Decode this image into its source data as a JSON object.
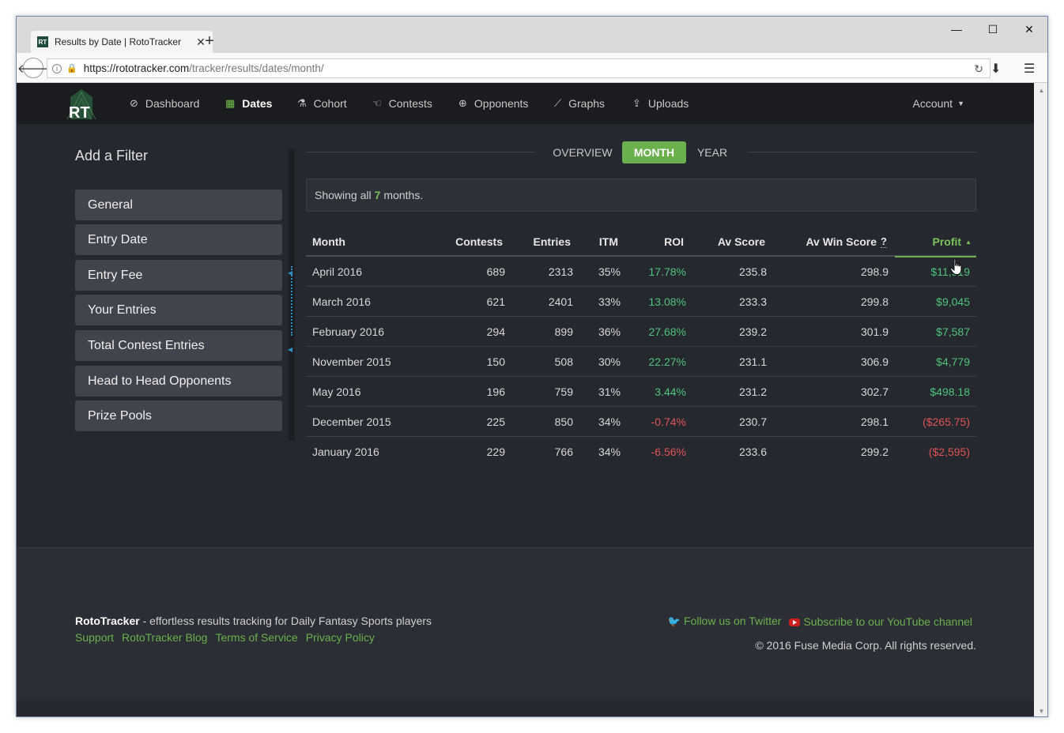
{
  "browser": {
    "tab_title": "Results by Date | RotoTracker",
    "tab_favicon": "RT",
    "url_host": "https://rototracker.com",
    "url_path": "/tracker/results/dates/month/"
  },
  "nav": {
    "items": [
      {
        "label": "Dashboard",
        "icon": "compass-icon"
      },
      {
        "label": "Dates",
        "icon": "calendar-icon",
        "active": true
      },
      {
        "label": "Cohort",
        "icon": "flask-icon"
      },
      {
        "label": "Contests",
        "icon": "hand-icon"
      },
      {
        "label": "Opponents",
        "icon": "crosshair-icon"
      },
      {
        "label": "Graphs",
        "icon": "line-chart-icon"
      },
      {
        "label": "Uploads",
        "icon": "upload-icon"
      }
    ],
    "account_label": "Account"
  },
  "sidebar": {
    "title": "Add a Filter",
    "filters": [
      "General",
      "Entry Date",
      "Entry Fee",
      "Your Entries",
      "Total Contest Entries",
      "Head to Head Opponents",
      "Prize Pools"
    ]
  },
  "view_tabs": {
    "overview": "OVERVIEW",
    "month": "MONTH",
    "year": "YEAR",
    "active": "MONTH"
  },
  "summary": {
    "prefix": "Showing all",
    "count": "7",
    "suffix": "months."
  },
  "table": {
    "headers": {
      "month": "Month",
      "contests": "Contests",
      "entries": "Entries",
      "itm": "ITM",
      "roi": "ROI",
      "av_score": "Av Score",
      "av_win_score": "Av Win Score",
      "av_win_score_hint": "?",
      "profit": "Profit"
    },
    "sort_column": "Profit",
    "sort_direction": "desc",
    "rows": [
      {
        "month": "April 2016",
        "contests": "689",
        "entries": "2313",
        "itm": "35%",
        "roi": "17.78%",
        "av_score": "235.8",
        "av_win_score": "298.9",
        "profit": "$11,919",
        "positive": true
      },
      {
        "month": "March 2016",
        "contests": "621",
        "entries": "2401",
        "itm": "33%",
        "roi": "13.08%",
        "av_score": "233.3",
        "av_win_score": "299.8",
        "profit": "$9,045",
        "positive": true
      },
      {
        "month": "February 2016",
        "contests": "294",
        "entries": "899",
        "itm": "36%",
        "roi": "27.68%",
        "av_score": "239.2",
        "av_win_score": "301.9",
        "profit": "$7,587",
        "positive": true
      },
      {
        "month": "November 2015",
        "contests": "150",
        "entries": "508",
        "itm": "30%",
        "roi": "22.27%",
        "av_score": "231.1",
        "av_win_score": "306.9",
        "profit": "$4,779",
        "positive": true
      },
      {
        "month": "May 2016",
        "contests": "196",
        "entries": "759",
        "itm": "31%",
        "roi": "3.44%",
        "av_score": "231.2",
        "av_win_score": "302.7",
        "profit": "$498.18",
        "positive": true
      },
      {
        "month": "December 2015",
        "contests": "225",
        "entries": "850",
        "itm": "34%",
        "roi": "-0.74%",
        "av_score": "230.7",
        "av_win_score": "298.1",
        "profit": "($265.75)",
        "positive": false
      },
      {
        "month": "January 2016",
        "contests": "229",
        "entries": "766",
        "itm": "34%",
        "roi": "-6.56%",
        "av_score": "233.6",
        "av_win_score": "299.2",
        "profit": "($2,595)",
        "positive": false
      }
    ]
  },
  "footer": {
    "brand": "RotoTracker",
    "tagline": " - effortless results tracking for Daily Fantasy Sports players",
    "links": [
      "Support",
      "RotoTracker Blog",
      "Terms of Service",
      "Privacy Policy"
    ],
    "twitter": "Follow us on Twitter",
    "youtube": "Subscribe to our YouTube channel",
    "copyright": "© 2016 Fuse Media Corp. All rights reserved."
  },
  "colors": {
    "accent": "#6ab04c",
    "positive": "#4fc37a",
    "negative": "#e05454",
    "background": "#25282e",
    "navbar": "#1a1c20"
  }
}
